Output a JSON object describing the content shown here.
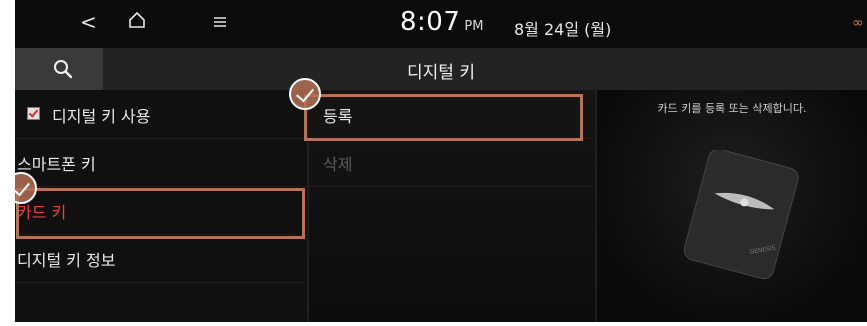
{
  "status_bar": {
    "back_icon": "chevron-left-icon",
    "home_icon": "home-icon",
    "menu_icon": "menu-icon",
    "time": "8:07",
    "ampm": "PM",
    "date": "8월 24일 (월)",
    "status_glyph": "∞",
    "accent_color": "#d0713a"
  },
  "title_bar": {
    "search_icon": "search-icon",
    "title": "디지털 키"
  },
  "left_menu": {
    "items": [
      {
        "label": "디지털 키 사용",
        "type": "checkbox",
        "checked": true
      },
      {
        "label": "스마트폰 키"
      },
      {
        "label": "카드 키",
        "selected": true
      },
      {
        "label": "디지털 키 정보"
      }
    ],
    "selected_color": "#e0413a"
  },
  "mid_menu": {
    "items": [
      {
        "label": "등록",
        "enabled": true
      },
      {
        "label": "삭제",
        "enabled": false
      }
    ]
  },
  "right_panel": {
    "description": "카드 키를 등록 또는 삭제합니다.",
    "card_brand": "GENESIS"
  },
  "annotations": {
    "frame_color": "#b5735a",
    "badge_icon": "check-circle-icon"
  }
}
